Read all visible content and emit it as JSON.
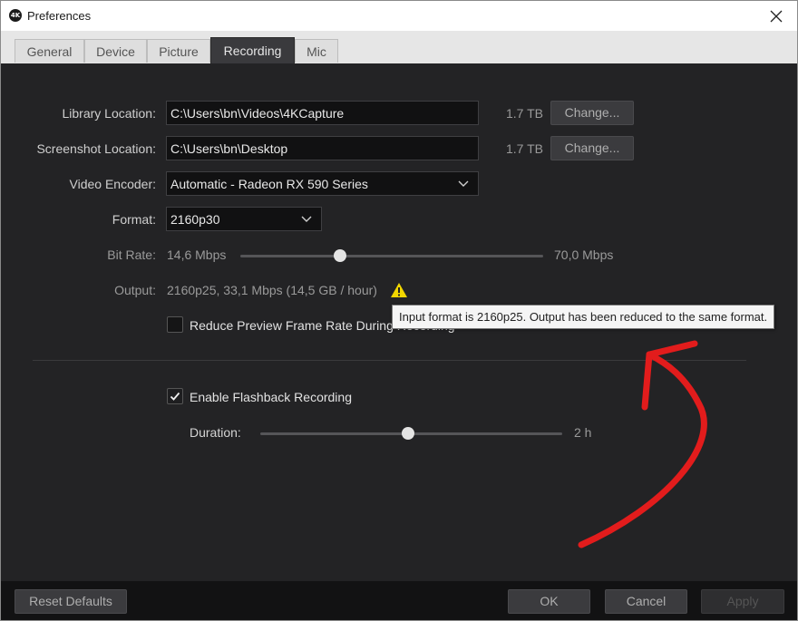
{
  "window": {
    "title": "Preferences",
    "app_icon_text": "4K"
  },
  "tabs": [
    {
      "label": "General"
    },
    {
      "label": "Device"
    },
    {
      "label": "Picture"
    },
    {
      "label": "Recording",
      "active": true
    },
    {
      "label": "Mic"
    }
  ],
  "library": {
    "label": "Library Location:",
    "path": "C:\\Users\\bn\\Videos\\4KCapture",
    "free_space": "1.7 TB",
    "change_label": "Change..."
  },
  "screenshot": {
    "label": "Screenshot Location:",
    "path": "C:\\Users\\bn\\Desktop",
    "free_space": "1.7 TB",
    "change_label": "Change..."
  },
  "encoder": {
    "label": "Video Encoder:",
    "value": "Automatic - Radeon RX 590 Series"
  },
  "format": {
    "label": "Format:",
    "value": "2160p30"
  },
  "bitrate": {
    "label": "Bit Rate:",
    "min_text": "14,6 Mbps",
    "max_text": "70,0 Mbps",
    "level": 0.33
  },
  "output": {
    "label": "Output:",
    "value": "2160p25, 33,1 Mbps (14,5 GB / hour)"
  },
  "reduce_preview": {
    "label": "Reduce Preview Frame Rate During Recording",
    "checked": false
  },
  "tooltip": {
    "text": "Input format is 2160p25. Output has been reduced to the same format."
  },
  "flashback": {
    "label": "Enable Flashback Recording",
    "checked": true,
    "duration_label": "Duration:",
    "duration_value": "2 h",
    "level": 0.49
  },
  "footer": {
    "reset_label": "Reset Defaults",
    "ok_label": "OK",
    "cancel_label": "Cancel",
    "apply_label": "Apply"
  },
  "colors": {
    "panel_bg": "#232325",
    "warning": "#f2d600",
    "annotation": "#e21c1c"
  }
}
